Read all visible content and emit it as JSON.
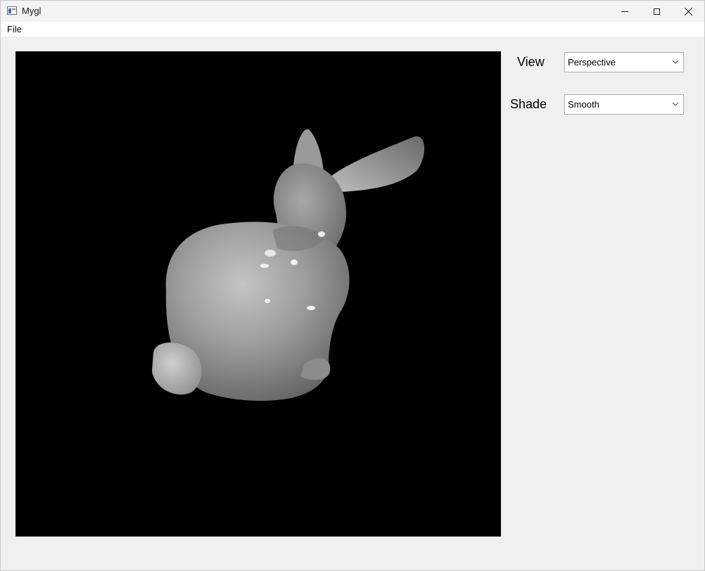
{
  "window": {
    "title": "Mygl",
    "icon": "app-window-icon"
  },
  "menubar": {
    "items": [
      {
        "label": "File"
      }
    ]
  },
  "viewport": {
    "background": "#000000",
    "content": "bunny-model"
  },
  "controls": {
    "view": {
      "label": "View",
      "value": "Perspective"
    },
    "shade": {
      "label": "Shade",
      "value": "Smooth"
    }
  },
  "icons": {
    "minimize": "minimize-icon",
    "maximize": "maximize-icon",
    "close": "close-icon",
    "dropdown": "chevron-down-icon"
  }
}
